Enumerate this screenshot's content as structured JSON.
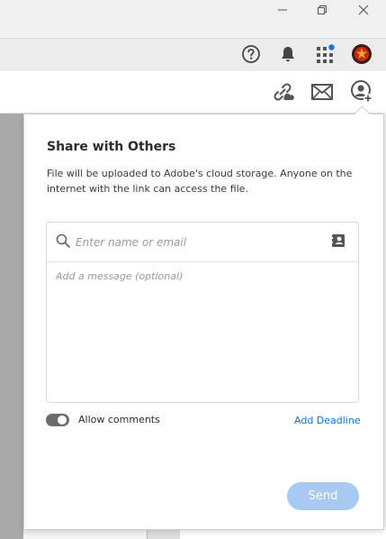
{
  "window": {
    "controls": {
      "minimize_icon": "minimize-icon",
      "restore_icon": "restore-icon",
      "close_icon": "close-icon"
    }
  },
  "top_toolbar": {
    "icons": [
      "help-icon",
      "bell-icon",
      "apps-grid-icon",
      "avatar"
    ],
    "apps_badge_color": "#1473e6"
  },
  "share_toolbar": {
    "icons": [
      "share-link-icon",
      "email-icon",
      "share-people-icon"
    ]
  },
  "panel": {
    "title": "Share with Others",
    "description": "File will be uploaded to Adobe's cloud storage. Anyone on the internet with the link can access the file.",
    "recipient_placeholder": "Enter name or email",
    "message_placeholder": "Add a message (optional)",
    "allow_comments_label": "Allow comments",
    "allow_comments_enabled": true,
    "add_deadline_label": "Add Deadline",
    "send_label": "Send",
    "accent_color": "#1473e6"
  }
}
